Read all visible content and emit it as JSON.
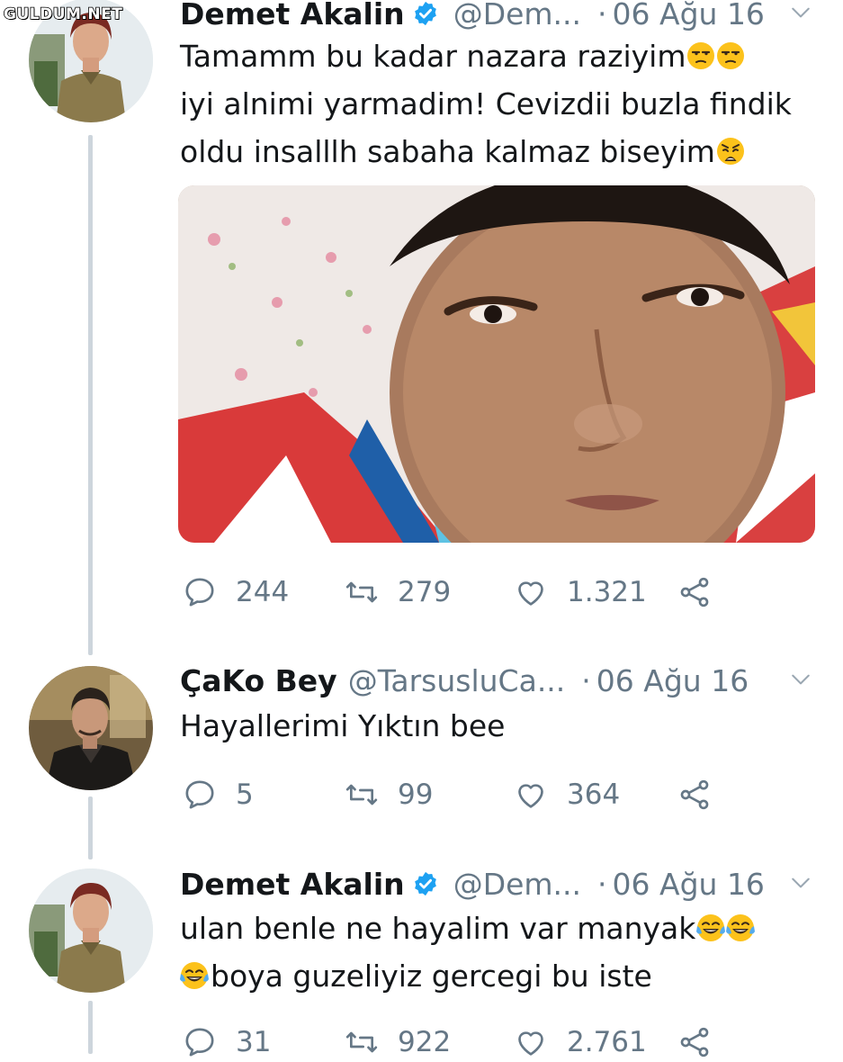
{
  "watermark": "GULDUM.NET",
  "tweets": [
    {
      "name": "Demet Akalin",
      "verified": true,
      "handle": "@Dem...",
      "date": "06 Ağu 16",
      "lines": [
        "Tamamm bu kadar nazara raziyim",
        "iyi alnimi yarmadim! Cevizdii buzla findik",
        "oldu insalllh sabaha kalmaz biseyim"
      ],
      "emojis": [
        "unamused-face",
        "unamused-face",
        "weary-face"
      ],
      "replies": "244",
      "retweets": "279",
      "likes": "1.321"
    },
    {
      "name": "ÇaKo Bey",
      "verified": false,
      "handle": "@TarsusluCa...",
      "date": "06 Ağu 16",
      "lines": [
        "Hayallerimi Yıktın bee"
      ],
      "replies": "5",
      "retweets": "99",
      "likes": "364"
    },
    {
      "name": "Demet Akalin",
      "verified": true,
      "handle": "@Dem...",
      "date": "06 Ağu 16",
      "lines": [
        "ulan benle ne hayalim var manyak",
        "boya guzeliyiz gercegi bu iste"
      ],
      "emojis": [
        "tears-of-joy-face",
        "tears-of-joy-face",
        "tears-of-joy-face"
      ],
      "replies": "31",
      "retweets": "922",
      "likes": "2.761"
    }
  ],
  "colors": {
    "text": "#14171a",
    "muted": "#657786",
    "verified": "#1da1f2",
    "thread_line": "#cdd5dc"
  }
}
